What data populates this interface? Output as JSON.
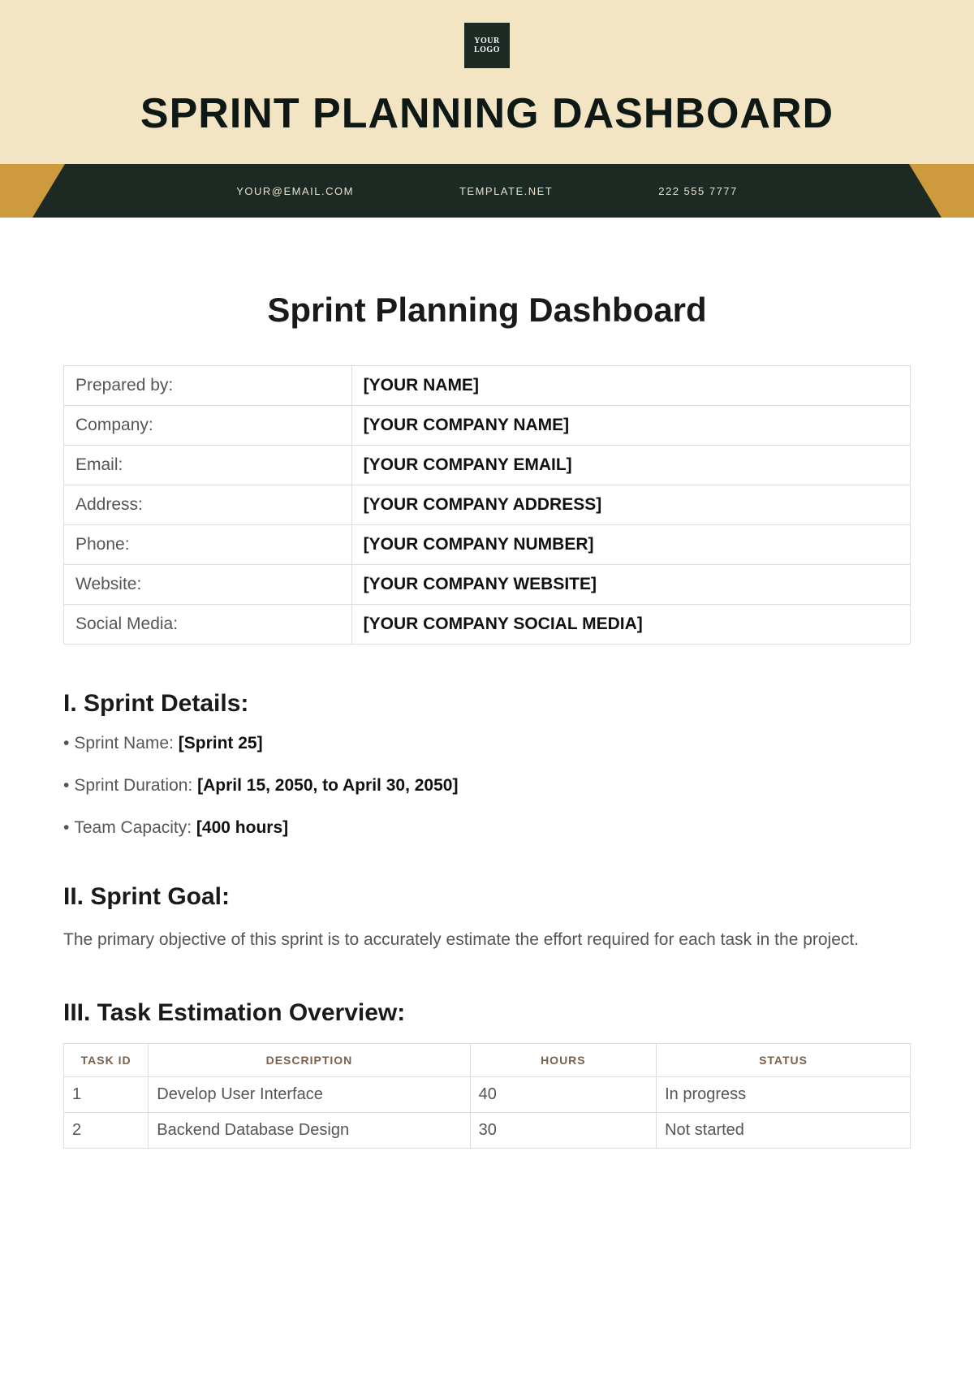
{
  "hero": {
    "logo_text": "YOUR\nLOGO",
    "title": "SPRINT PLANNING DASHBOARD"
  },
  "contact_band": {
    "email": "YOUR@EMAIL.COM",
    "site": "TEMPLATE.NET",
    "phone": "222 555 7777"
  },
  "doc_title": "Sprint Planning Dashboard",
  "info_rows": [
    {
      "label": "Prepared by:",
      "value": "[YOUR NAME]"
    },
    {
      "label": "Company:",
      "value": "[YOUR COMPANY NAME]"
    },
    {
      "label": "Email:",
      "value": "[YOUR COMPANY EMAIL]"
    },
    {
      "label": "Address:",
      "value": "[YOUR COMPANY ADDRESS]"
    },
    {
      "label": "Phone:",
      "value": "[YOUR COMPANY NUMBER]"
    },
    {
      "label": "Website:",
      "value": "[YOUR COMPANY WEBSITE]"
    },
    {
      "label": "Social Media:",
      "value": "[YOUR COMPANY SOCIAL MEDIA]"
    }
  ],
  "sections": {
    "sprint_details": {
      "heading": "I. Sprint Details:",
      "items": [
        {
          "label": "Sprint Name:",
          "value": "[Sprint 25]"
        },
        {
          "label": "Sprint Duration:",
          "value": "[April 15, 2050, to April 30, 2050]"
        },
        {
          "label": "Team Capacity:",
          "value": "[400 hours]"
        }
      ]
    },
    "sprint_goal": {
      "heading": "II. Sprint Goal:",
      "text": "The primary objective of this sprint is to accurately estimate the effort required for each task in the project."
    },
    "task_overview": {
      "heading": "III. Task Estimation Overview:",
      "columns": [
        "TASK ID",
        "DESCRIPTION",
        "HOURS",
        "STATUS"
      ],
      "rows": [
        {
          "id": "1",
          "desc": "Develop User Interface",
          "hours": "40",
          "status": "In progress"
        },
        {
          "id": "2",
          "desc": "Backend Database Design",
          "hours": "30",
          "status": "Not started"
        }
      ]
    }
  }
}
